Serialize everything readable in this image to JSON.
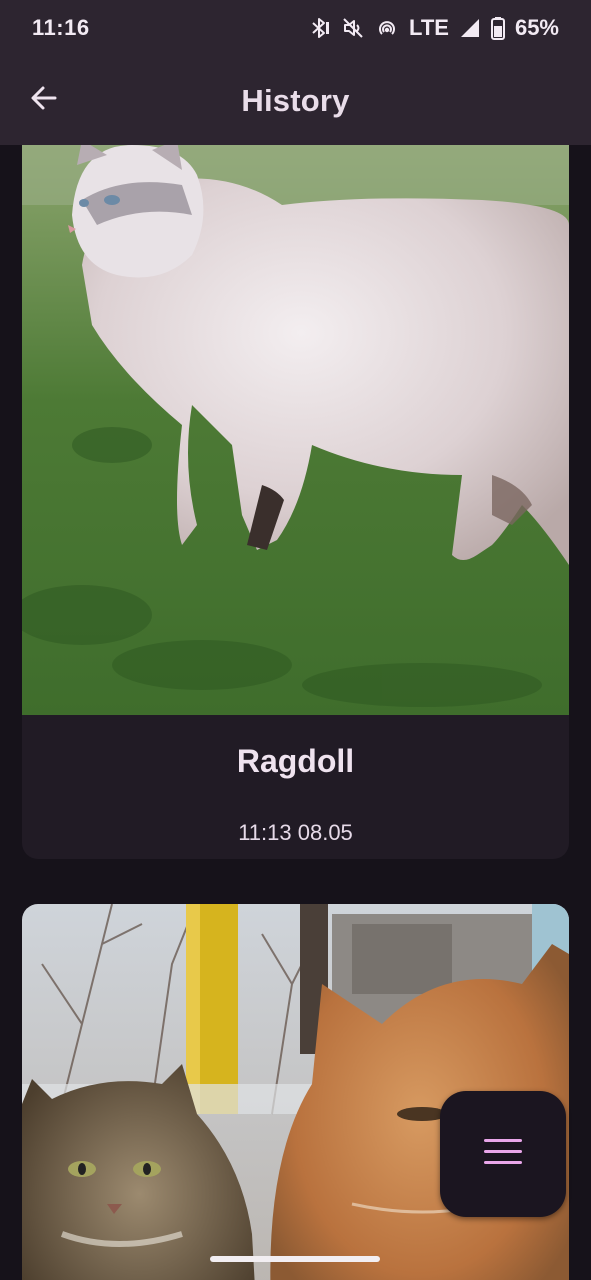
{
  "status_bar": {
    "time": "11:16",
    "network": "LTE",
    "battery": "65%",
    "icons": [
      "bluetooth-icon",
      "mute-icon",
      "hotspot-icon",
      "signal-icon",
      "battery-icon"
    ]
  },
  "app_bar": {
    "title": "History",
    "back_icon": "arrow-left-icon"
  },
  "history": [
    {
      "breed": "Ragdoll",
      "timestamp": "11:13 08.05",
      "image": "white-cat-on-grass-photo"
    },
    {
      "breed": "",
      "timestamp": "",
      "image": "two-fluffy-cats-in-snow-photo"
    }
  ],
  "fab": {
    "icon": "menu-icon"
  },
  "colors": {
    "app_bar_bg": "#2d2530",
    "page_bg": "#16121a",
    "card_bg": "#211b25",
    "fab_icon": "#e9a6ea"
  }
}
